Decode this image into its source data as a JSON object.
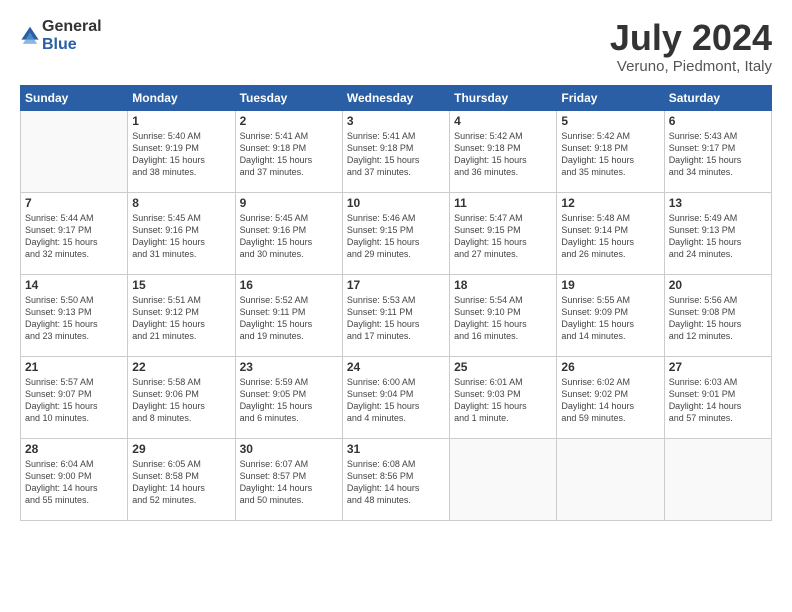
{
  "header": {
    "logo_general": "General",
    "logo_blue": "Blue",
    "month_title": "July 2024",
    "location": "Veruno, Piedmont, Italy"
  },
  "weekdays": [
    "Sunday",
    "Monday",
    "Tuesday",
    "Wednesday",
    "Thursday",
    "Friday",
    "Saturday"
  ],
  "weeks": [
    [
      {
        "day": "",
        "info": ""
      },
      {
        "day": "1",
        "info": "Sunrise: 5:40 AM\nSunset: 9:19 PM\nDaylight: 15 hours\nand 38 minutes."
      },
      {
        "day": "2",
        "info": "Sunrise: 5:41 AM\nSunset: 9:18 PM\nDaylight: 15 hours\nand 37 minutes."
      },
      {
        "day": "3",
        "info": "Sunrise: 5:41 AM\nSunset: 9:18 PM\nDaylight: 15 hours\nand 37 minutes."
      },
      {
        "day": "4",
        "info": "Sunrise: 5:42 AM\nSunset: 9:18 PM\nDaylight: 15 hours\nand 36 minutes."
      },
      {
        "day": "5",
        "info": "Sunrise: 5:42 AM\nSunset: 9:18 PM\nDaylight: 15 hours\nand 35 minutes."
      },
      {
        "day": "6",
        "info": "Sunrise: 5:43 AM\nSunset: 9:17 PM\nDaylight: 15 hours\nand 34 minutes."
      }
    ],
    [
      {
        "day": "7",
        "info": "Sunrise: 5:44 AM\nSunset: 9:17 PM\nDaylight: 15 hours\nand 32 minutes."
      },
      {
        "day": "8",
        "info": "Sunrise: 5:45 AM\nSunset: 9:16 PM\nDaylight: 15 hours\nand 31 minutes."
      },
      {
        "day": "9",
        "info": "Sunrise: 5:45 AM\nSunset: 9:16 PM\nDaylight: 15 hours\nand 30 minutes."
      },
      {
        "day": "10",
        "info": "Sunrise: 5:46 AM\nSunset: 9:15 PM\nDaylight: 15 hours\nand 29 minutes."
      },
      {
        "day": "11",
        "info": "Sunrise: 5:47 AM\nSunset: 9:15 PM\nDaylight: 15 hours\nand 27 minutes."
      },
      {
        "day": "12",
        "info": "Sunrise: 5:48 AM\nSunset: 9:14 PM\nDaylight: 15 hours\nand 26 minutes."
      },
      {
        "day": "13",
        "info": "Sunrise: 5:49 AM\nSunset: 9:13 PM\nDaylight: 15 hours\nand 24 minutes."
      }
    ],
    [
      {
        "day": "14",
        "info": "Sunrise: 5:50 AM\nSunset: 9:13 PM\nDaylight: 15 hours\nand 23 minutes."
      },
      {
        "day": "15",
        "info": "Sunrise: 5:51 AM\nSunset: 9:12 PM\nDaylight: 15 hours\nand 21 minutes."
      },
      {
        "day": "16",
        "info": "Sunrise: 5:52 AM\nSunset: 9:11 PM\nDaylight: 15 hours\nand 19 minutes."
      },
      {
        "day": "17",
        "info": "Sunrise: 5:53 AM\nSunset: 9:11 PM\nDaylight: 15 hours\nand 17 minutes."
      },
      {
        "day": "18",
        "info": "Sunrise: 5:54 AM\nSunset: 9:10 PM\nDaylight: 15 hours\nand 16 minutes."
      },
      {
        "day": "19",
        "info": "Sunrise: 5:55 AM\nSunset: 9:09 PM\nDaylight: 15 hours\nand 14 minutes."
      },
      {
        "day": "20",
        "info": "Sunrise: 5:56 AM\nSunset: 9:08 PM\nDaylight: 15 hours\nand 12 minutes."
      }
    ],
    [
      {
        "day": "21",
        "info": "Sunrise: 5:57 AM\nSunset: 9:07 PM\nDaylight: 15 hours\nand 10 minutes."
      },
      {
        "day": "22",
        "info": "Sunrise: 5:58 AM\nSunset: 9:06 PM\nDaylight: 15 hours\nand 8 minutes."
      },
      {
        "day": "23",
        "info": "Sunrise: 5:59 AM\nSunset: 9:05 PM\nDaylight: 15 hours\nand 6 minutes."
      },
      {
        "day": "24",
        "info": "Sunrise: 6:00 AM\nSunset: 9:04 PM\nDaylight: 15 hours\nand 4 minutes."
      },
      {
        "day": "25",
        "info": "Sunrise: 6:01 AM\nSunset: 9:03 PM\nDaylight: 15 hours\nand 1 minute."
      },
      {
        "day": "26",
        "info": "Sunrise: 6:02 AM\nSunset: 9:02 PM\nDaylight: 14 hours\nand 59 minutes."
      },
      {
        "day": "27",
        "info": "Sunrise: 6:03 AM\nSunset: 9:01 PM\nDaylight: 14 hours\nand 57 minutes."
      }
    ],
    [
      {
        "day": "28",
        "info": "Sunrise: 6:04 AM\nSunset: 9:00 PM\nDaylight: 14 hours\nand 55 minutes."
      },
      {
        "day": "29",
        "info": "Sunrise: 6:05 AM\nSunset: 8:58 PM\nDaylight: 14 hours\nand 52 minutes."
      },
      {
        "day": "30",
        "info": "Sunrise: 6:07 AM\nSunset: 8:57 PM\nDaylight: 14 hours\nand 50 minutes."
      },
      {
        "day": "31",
        "info": "Sunrise: 6:08 AM\nSunset: 8:56 PM\nDaylight: 14 hours\nand 48 minutes."
      },
      {
        "day": "",
        "info": ""
      },
      {
        "day": "",
        "info": ""
      },
      {
        "day": "",
        "info": ""
      }
    ]
  ]
}
